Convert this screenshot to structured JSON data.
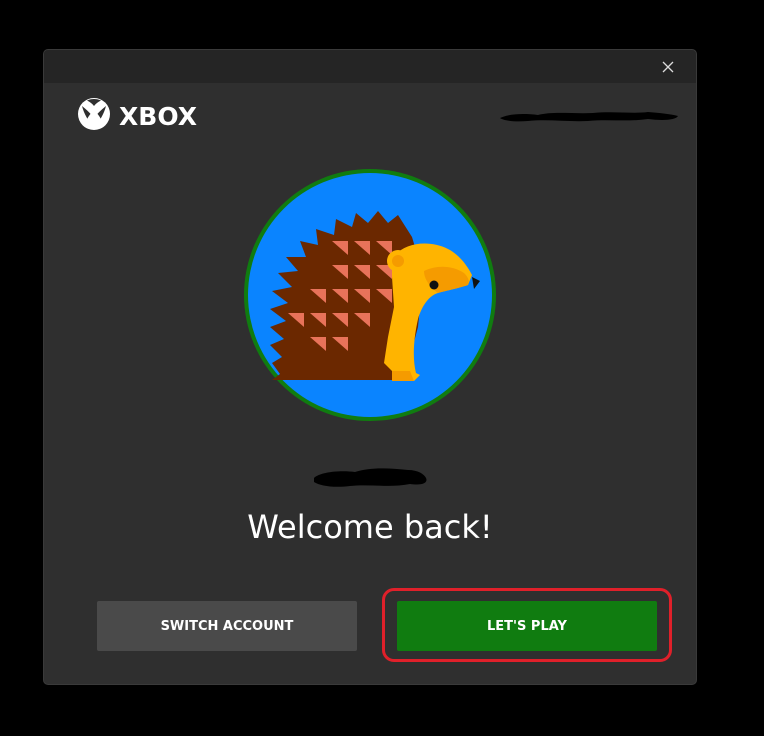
{
  "window": {
    "close_icon": "close-icon"
  },
  "brand": {
    "logo_icon": "xbox-sphere-icon",
    "logo_text": "XBOX"
  },
  "profile": {
    "avatar_icon": "hedgehog-avatar",
    "welcome_text": "Welcome back!"
  },
  "actions": {
    "switch_account_label": "SWITCH ACCOUNT",
    "lets_play_label": "LET'S PLAY"
  },
  "colors": {
    "dialog_bg": "#2f2f2f",
    "titlebar_bg": "#252525",
    "primary_button": "#107c10",
    "secondary_button": "#4a4a4a",
    "avatar_ring": "#107c10",
    "avatar_bg": "#0a84ff",
    "highlight": "#e0202a"
  }
}
